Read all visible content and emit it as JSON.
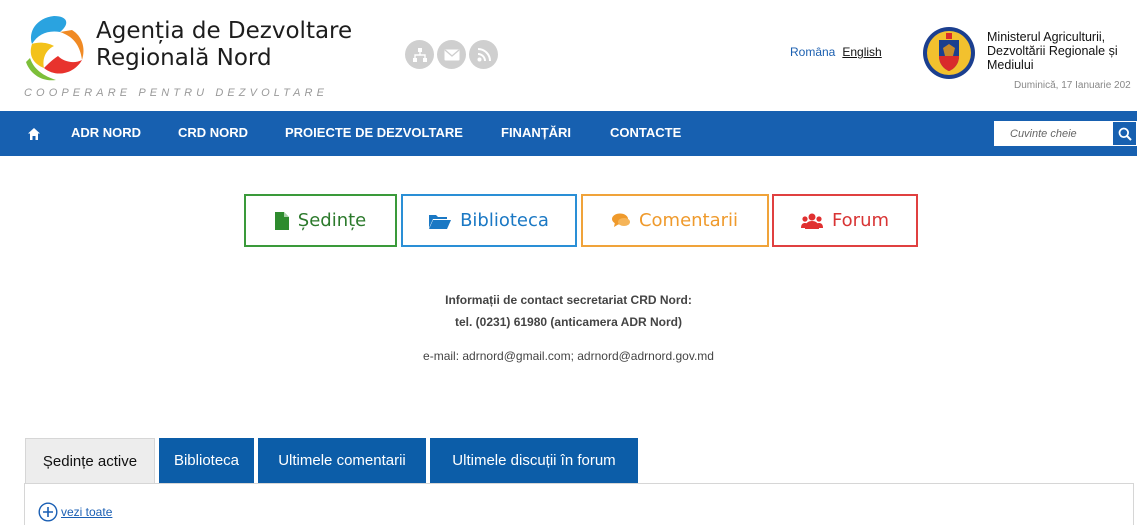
{
  "header": {
    "org_name_line1": "Agenția de Dezvoltare",
    "org_name_line2": "Regională Nord",
    "tagline": "COOPERARE PENTRU DEZVOLTARE",
    "social_icons": [
      "sitemap-icon",
      "email-icon",
      "rss-icon"
    ],
    "lang_ro": "Româna",
    "lang_en": "English",
    "ministry_line1": "Ministerul Agriculturii,",
    "ministry_line2": "Dezvoltării Regionale și",
    "ministry_line3": "Mediului",
    "date": "Duminică, 17 Ianuarie 202"
  },
  "nav": {
    "home_icon": "home-icon",
    "items": [
      "ADR NORD",
      "CRD NORD",
      "PROIECTE DE DEZVOLTARE",
      "FINANȚĂRI",
      "CONTACTE"
    ],
    "search_placeholder": "Cuvinte cheie",
    "search_icon": "search-icon"
  },
  "sections": [
    {
      "label": "Ședințe",
      "icon": "file-icon",
      "color": "#3a9a3a"
    },
    {
      "label": "Biblioteca",
      "icon": "folder-open-icon",
      "color": "#2a8fd6"
    },
    {
      "label": "Comentarii",
      "icon": "comments-icon",
      "color": "#f0a33a"
    },
    {
      "label": "Forum",
      "icon": "users-icon",
      "color": "#e04040"
    }
  ],
  "contact": {
    "line1": "Informații de contact secretariat CRD Nord:",
    "line2": "tel. (0231) 61980 (anticamera ADR Nord)",
    "email": "e-mail: adrnord@gmail.com; adrnord@adrnord.gov.md"
  },
  "tabs": [
    "Ședințe active",
    "Biblioteca",
    "Ultimele comentarii",
    "Ultimele discuții în forum"
  ],
  "panel": {
    "see_all": "vezi toate"
  },
  "colors": {
    "nav_blue": "#1760b0",
    "tab_blue": "#0c5da8",
    "link_blue": "#1a5fb4"
  }
}
